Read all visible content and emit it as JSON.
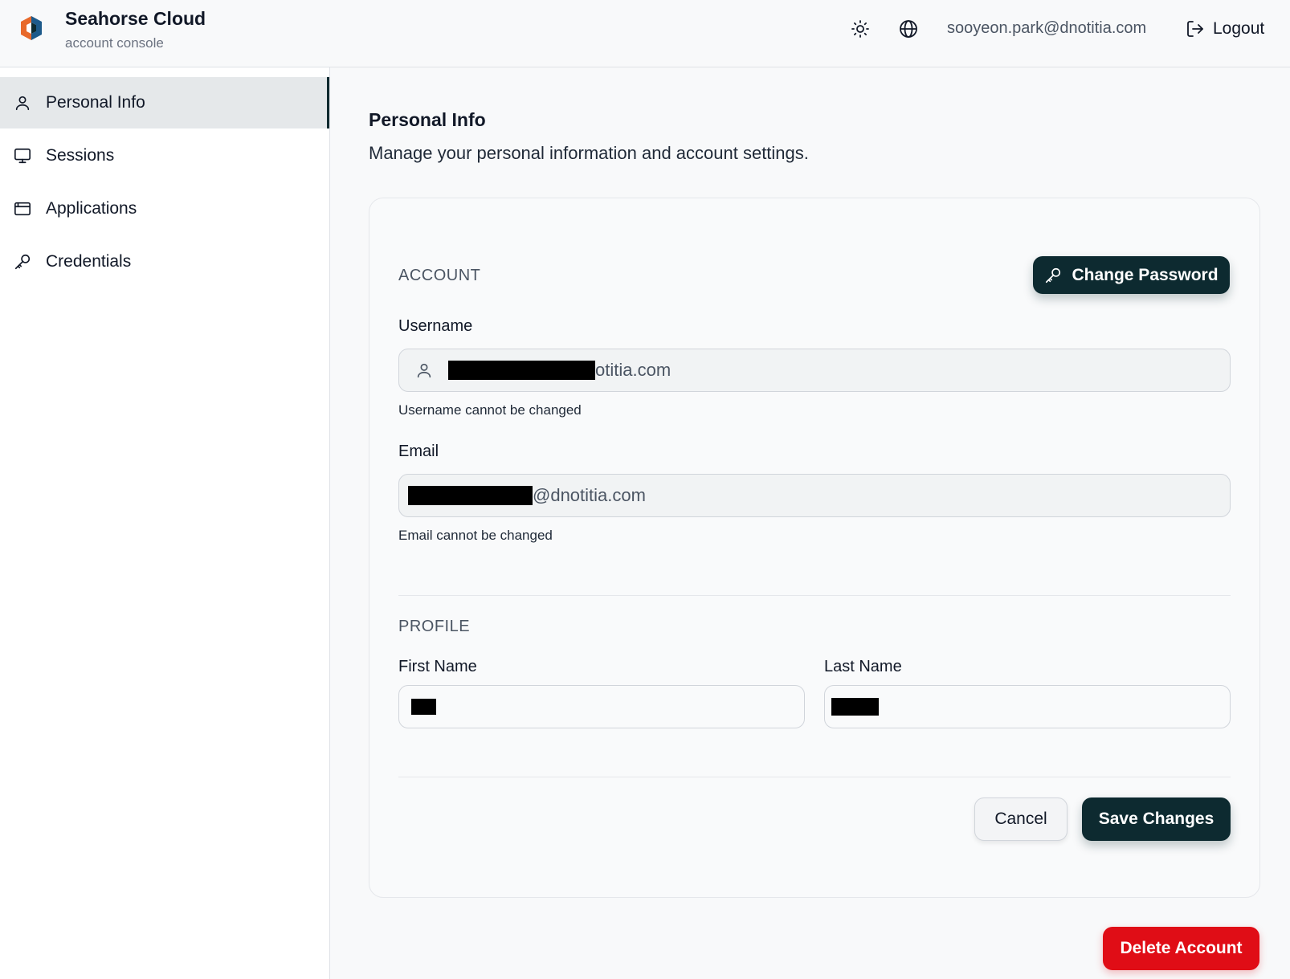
{
  "header": {
    "brand_title": "Seahorse Cloud",
    "brand_subtitle": "account console",
    "user_email": "sooyeon.park@dnotitia.com",
    "logout_label": "Logout",
    "icons": [
      "sun-icon",
      "globe-icon",
      "logout-icon"
    ]
  },
  "sidebar": {
    "items": [
      {
        "label": "Personal Info",
        "icon": "user-icon",
        "active": true
      },
      {
        "label": "Sessions",
        "icon": "monitor-icon",
        "active": false
      },
      {
        "label": "Applications",
        "icon": "window-icon",
        "active": false
      },
      {
        "label": "Credentials",
        "icon": "key-icon",
        "active": false
      }
    ]
  },
  "main": {
    "title": "Personal Info",
    "subtitle": "Manage your personal information and account settings.",
    "account": {
      "section_title": "ACCOUNT",
      "change_password_label": "Change Password",
      "username_label": "Username",
      "username_value_suffix": "otitia.com",
      "username_hint": "Username cannot be changed",
      "email_label": "Email",
      "email_value_suffix": "@dnotitia.com",
      "email_hint": "Email cannot be changed"
    },
    "profile": {
      "section_title": "PROFILE",
      "first_name_label": "First Name",
      "last_name_label": "Last Name"
    },
    "actions": {
      "cancel_label": "Cancel",
      "save_label": "Save Changes"
    },
    "delete_account_label": "Delete Account"
  },
  "colors": {
    "primary_dark": "#0d2a30",
    "danger": "#e00d16",
    "logo_orange": "#e8692a",
    "logo_blue": "#1d5a8a"
  }
}
